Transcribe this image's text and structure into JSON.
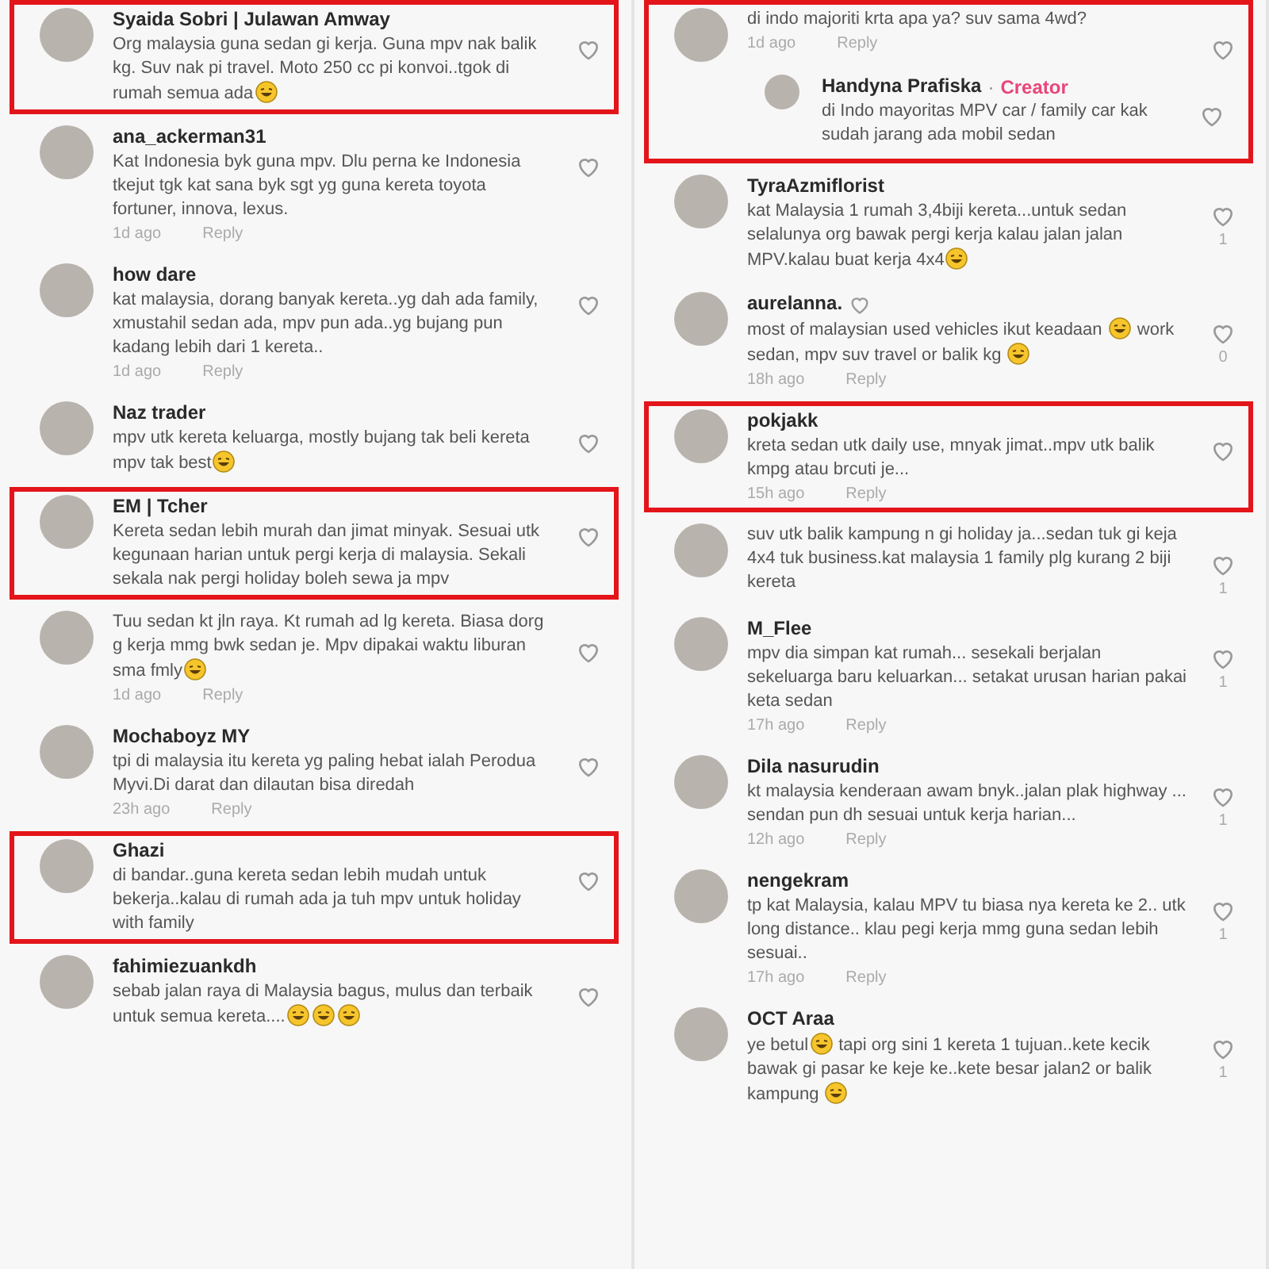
{
  "columns": [
    {
      "comments": [
        {
          "name": "Syaida Sobri | Julawan Amway",
          "highlighted": true,
          "body": [
            {
              "kind": "text",
              "text": "Org malaysia guna sedan gi kerja. Guna mpv nak balik kg. Suv nak pi travel. Moto 250 cc pi konvoi..tgok di rumah semua ada"
            },
            {
              "kind": "emoji"
            }
          ]
        },
        {
          "name": "ana_ackerman31",
          "highlighted": false,
          "body": [
            {
              "kind": "text",
              "text": "Kat Indonesia byk guna mpv. Dlu perna ke Indonesia tkejut tgk kat sana byk sgt yg guna kereta toyota fortuner, innova, lexus."
            }
          ],
          "time": "1d ago",
          "reply": "Reply"
        },
        {
          "name": "how dare",
          "highlighted": false,
          "body": [
            {
              "kind": "text",
              "text": "kat malaysia, dorang banyak kereta..yg dah ada family, xmustahil sedan ada, mpv pun ada..yg bujang pun kadang lebih dari 1 kereta.."
            }
          ],
          "time": "1d ago",
          "reply": "Reply"
        },
        {
          "name": "Naz trader",
          "highlighted": false,
          "body": [
            {
              "kind": "text",
              "text": "mpv utk kereta keluarga, mostly bujang tak beli kereta mpv tak best"
            },
            {
              "kind": "emoji"
            }
          ]
        },
        {
          "name": "EM | Tcher",
          "highlighted": true,
          "body": [
            {
              "kind": "text",
              "text": "Kereta sedan lebih murah dan jimat minyak. Sesuai utk kegunaan harian untuk pergi kerja di malaysia. Sekali sekala nak pergi holiday boleh sewa ja mpv"
            }
          ]
        },
        {
          "highlighted": false,
          "body": [
            {
              "kind": "text",
              "text": "Tuu sedan kt jln raya. Kt rumah ad lg kereta. Biasa dorg g kerja mmg bwk sedan je. Mpv dipakai waktu liburan sma fmly"
            },
            {
              "kind": "emoji"
            }
          ],
          "time": "1d ago",
          "reply": "Reply"
        },
        {
          "name": "Mochaboyz MY",
          "highlighted": false,
          "body": [
            {
              "kind": "text",
              "text": "tpi di malaysia itu kereta yg paling hebat ialah Perodua Myvi.Di darat dan dilautan bisa diredah"
            }
          ],
          "time": "23h ago",
          "reply": "Reply"
        },
        {
          "name": "Ghazi",
          "highlighted": true,
          "body": [
            {
              "kind": "text",
              "text": "di bandar..guna kereta sedan lebih mudah untuk bekerja..kalau di rumah ada ja tuh mpv untuk holiday with family"
            }
          ]
        },
        {
          "name": "fahimiezuankdh",
          "highlighted": false,
          "body": [
            {
              "kind": "text",
              "text": "sebab jalan raya di Malaysia bagus, mulus dan terbaik untuk semua kereta...."
            },
            {
              "kind": "emoji"
            },
            {
              "kind": "emoji"
            },
            {
              "kind": "emoji"
            }
          ]
        }
      ]
    },
    {
      "comments": [
        {
          "highlighted": true,
          "body": [
            {
              "kind": "text",
              "text": "di indo majoriti krta apa ya? suv sama 4wd?"
            }
          ],
          "time": "1d ago",
          "reply": "Reply",
          "children": [
            {
              "name": "Handyna Prafiska",
              "badge": "Creator",
              "separator": "·",
              "highlighted": false,
              "body": [
                {
                  "kind": "text",
                  "text": "di Indo mayoritas MPV car / family car kak sudah jarang ada mobil sedan"
                }
              ]
            }
          ]
        },
        {
          "name": "TyraAzmiflorist",
          "highlighted": false,
          "likes": "1",
          "body": [
            {
              "kind": "text",
              "text": "kat Malaysia 1 rumah 3,4biji kereta...untuk sedan selalunya org bawak pergi kerja kalau jalan jalan MPV.kalau buat kerja 4x4"
            },
            {
              "kind": "emoji"
            }
          ]
        },
        {
          "name": "aurelanna.",
          "name_heart": true,
          "highlighted": false,
          "likes": "0",
          "body": [
            {
              "kind": "text",
              "text": "most of malaysian used vehicles ikut keadaan "
            },
            {
              "kind": "emoji"
            },
            {
              "kind": "text",
              "text": " work sedan, mpv suv travel or balik kg "
            },
            {
              "kind": "emoji"
            }
          ],
          "time": "18h ago",
          "reply": "Reply"
        },
        {
          "name": "pokjakk",
          "highlighted": true,
          "body": [
            {
              "kind": "text",
              "text": "kreta sedan utk daily use, mnyak jimat..mpv utk balik kmpg atau brcuti je..."
            }
          ],
          "time": "15h ago",
          "reply": "Reply"
        },
        {
          "highlighted": false,
          "likes": "1",
          "body": [
            {
              "kind": "text",
              "text": "suv utk balik kampung n gi holiday ja...sedan tuk gi keja 4x4 tuk business.kat malaysia 1 family plg kurang 2 biji kereta"
            }
          ]
        },
        {
          "name": "M_Flee",
          "highlighted": false,
          "likes": "1",
          "body": [
            {
              "kind": "text",
              "text": "mpv dia simpan kat rumah... sesekali berjalan sekeluarga baru keluarkan... setakat urusan harian pakai keta sedan"
            }
          ],
          "time": "17h ago",
          "reply": "Reply"
        },
        {
          "name": "Dila nasurudin",
          "highlighted": false,
          "likes": "1",
          "body": [
            {
              "kind": "text",
              "text": "kt malaysia kenderaan awam bnyk..jalan plak highway ... sendan pun dh sesuai untuk kerja harian..."
            }
          ],
          "time": "12h ago",
          "reply": "Reply"
        },
        {
          "name": "nengekram",
          "highlighted": false,
          "likes": "1",
          "body": [
            {
              "kind": "text",
              "text": "tp kat Malaysia, kalau MPV tu biasa nya kereta ke 2.. utk long distance.. klau pegi kerja mmg guna sedan lebih sesuai.."
            }
          ],
          "time": "17h ago",
          "reply": "Reply"
        },
        {
          "name": "OCT Araa",
          "highlighted": false,
          "likes": "1",
          "body": [
            {
              "kind": "text",
              "text": "ye betul"
            },
            {
              "kind": "emoji"
            },
            {
              "kind": "text",
              "text": " tapi org sini 1 kereta 1 tujuan..kete kecik bawak gi pasar ke keje ke..kete besar jalan2 or balik kampung "
            },
            {
              "kind": "emoji"
            }
          ]
        }
      ]
    }
  ]
}
